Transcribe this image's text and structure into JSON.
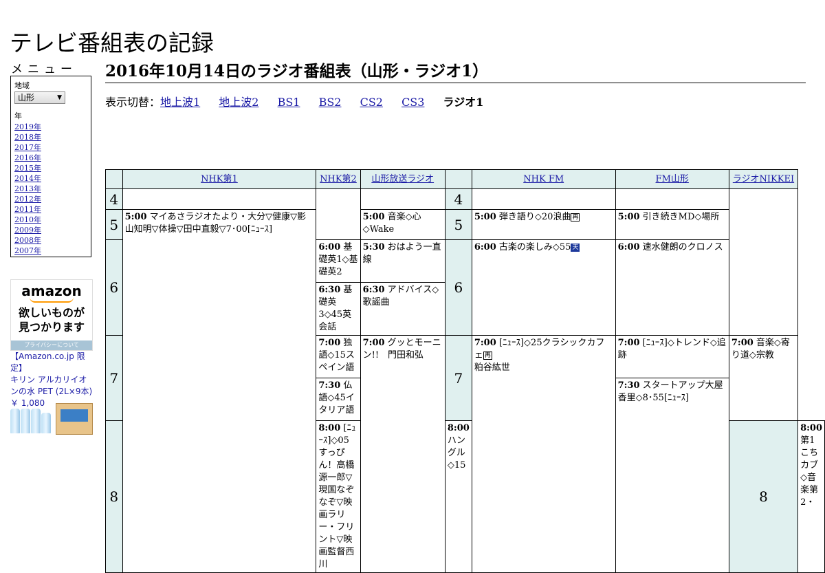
{
  "site": {
    "title": "テレビ番組表の記録"
  },
  "menu": {
    "heading": "メニュー",
    "region_label": "地域",
    "region_value": "山形",
    "year_label": "年",
    "years": [
      "2019年",
      "2018年",
      "2017年",
      "2016年",
      "2015年",
      "2014年",
      "2013年",
      "2012年",
      "2011年",
      "2010年",
      "2009年",
      "2008年",
      "2007年"
    ]
  },
  "ad": {
    "logo": "amazon",
    "tagline_1": "欲しいものが",
    "tagline_2": "見つかります",
    "privacy": "プライバシーについて",
    "product_line1": "【Amazon.co.jp 限定】",
    "product_line2": "キリン アルカリイオ",
    "product_line3": "ンの水 PET (2L×9本)",
    "price": "￥ 1,080"
  },
  "page": {
    "title": "2016年10月14日のラジオ番組表（山形・ラジオ1）"
  },
  "switcher": {
    "prefix": "表示切替：",
    "links": [
      "地上波1",
      "地上波2",
      "BS1",
      "BS2",
      "CS2",
      "CS3"
    ],
    "current": "ラジオ1"
  },
  "table": {
    "channels": [
      "NHK第1",
      "NHK第2",
      "山形放送ラジオ",
      "NHK FM",
      "FM山形",
      "ラジオNIKKEI"
    ],
    "hours": [
      "4",
      "5",
      "6",
      "7",
      "8"
    ],
    "marks": {
      "rerun": "再",
      "weather": "天"
    },
    "programs": {
      "nhk1_5": {
        "time": "5:00",
        "title": "マイあさラジオたより・大分▽健康▽影山知明▽体操▽田中直毅▽7･00[ﾆｭｰｽ]"
      },
      "nhk1_8": {
        "time": "8:00",
        "title": "[ﾆｭｰｽ]◇05すっぴん！高橋源一郎▽現国なぞなぞ▽映画ラリー・フリント▽映画監督西川"
      },
      "nhk2_600": {
        "time": "6:00",
        "title": "基礎英1◇基礎英2"
      },
      "nhk2_630": {
        "time": "6:30",
        "title": "基礎英3◇45英会話"
      },
      "nhk2_700": {
        "time": "7:00",
        "title": "独語◇15スペイン語"
      },
      "nhk2_730": {
        "time": "7:30",
        "title": "仏語◇45イタリア語"
      },
      "nhk2_800": {
        "time": "8:00",
        "title": "ハングル◇15"
      },
      "ybc_500": {
        "time": "5:00",
        "title": "音楽◇心◇Wake"
      },
      "ybc_530": {
        "time": "5:30",
        "title": "おはよう一直線"
      },
      "ybc_630": {
        "time": "6:30",
        "title": "アドバイス◇歌謡曲"
      },
      "ybc_700": {
        "time": "7:00",
        "title": "グッとモーニン!!　門田和弘"
      },
      "nhkfm_500": {
        "time": "5:00",
        "title": "弾き語り◇20浪曲"
      },
      "nhkfm_600": {
        "time": "6:00",
        "title": "古楽の楽しみ◇55"
      },
      "nhkfm_700": {
        "time": "7:00",
        "title": "[ﾆｭｰｽ]◇25クラシックカフェ",
        "title2": "粕谷紘世"
      },
      "fmy_500": {
        "time": "5:00",
        "title": "引き続きMD◇場所"
      },
      "fmy_600": {
        "time": "6:00",
        "title": "速水健朗のクロノス"
      },
      "fmy_700": {
        "time": "7:00",
        "title": "[ﾆｭｰｽ]◇トレンド◇追跡"
      },
      "fmy_730": {
        "time": "7:30",
        "title": "スタートアップ大屋香里◇8･55[ﾆｭｰｽ]"
      },
      "nikkei_700": {
        "time": "7:00",
        "title": "音楽◇寄り道◇宗教"
      },
      "nikkei_800": {
        "time": "8:00",
        "title": "第1こちカブ◇音楽第2・"
      }
    }
  }
}
